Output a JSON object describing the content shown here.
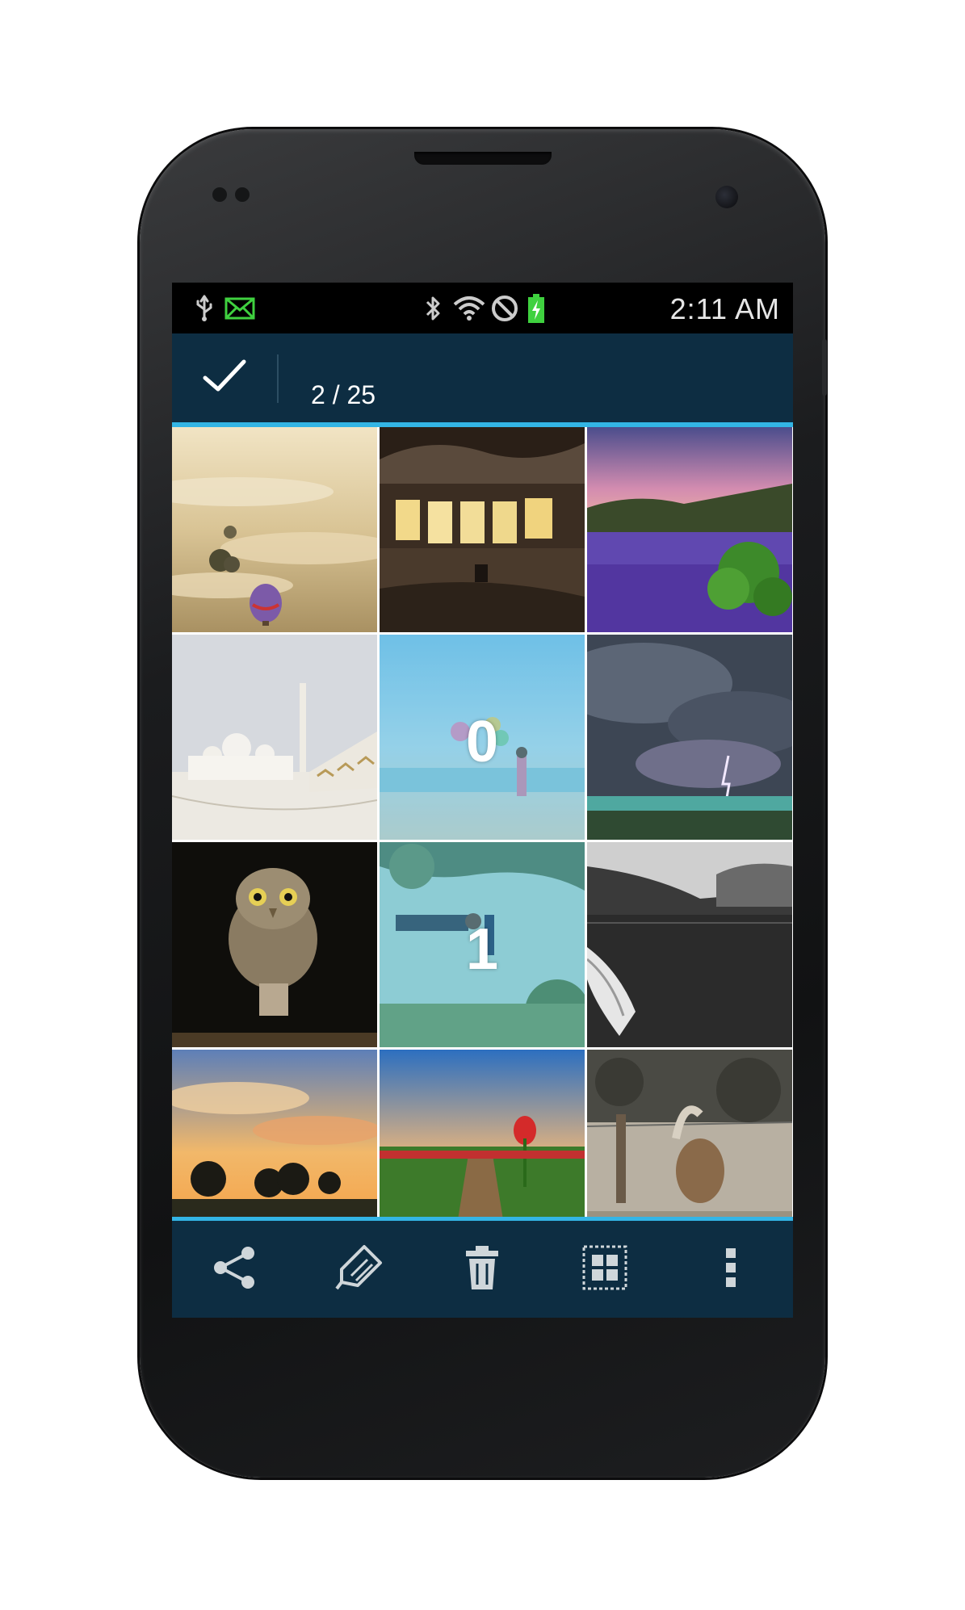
{
  "status_bar": {
    "time": "2:11 AM",
    "icons": [
      "usb-icon",
      "mail-icon",
      "bluetooth-icon",
      "wifi-icon",
      "blocked-icon",
      "battery-charging-icon"
    ]
  },
  "action_bar": {
    "done_icon": "checkmark-icon",
    "selection_count": "2 / 25"
  },
  "grid": {
    "tiles": [
      {
        "name": "fog-balloon-photo",
        "selected": false,
        "badge": ""
      },
      {
        "name": "abandoned-room-photo",
        "selected": false,
        "badge": ""
      },
      {
        "name": "lupine-field-photo",
        "selected": false,
        "badge": ""
      },
      {
        "name": "white-mosque-photo",
        "selected": false,
        "badge": ""
      },
      {
        "name": "beach-girl-balloons-photo",
        "selected": true,
        "badge": "0"
      },
      {
        "name": "storm-lightning-photo",
        "selected": false,
        "badge": ""
      },
      {
        "name": "owl-photo",
        "selected": false,
        "badge": ""
      },
      {
        "name": "couple-field-photo",
        "selected": true,
        "badge": "1"
      },
      {
        "name": "lake-canoe-photo",
        "selected": false,
        "badge": ""
      },
      {
        "name": "sunset-trees-photo",
        "selected": false,
        "badge": ""
      },
      {
        "name": "tulip-field-photo",
        "selected": false,
        "badge": ""
      },
      {
        "name": "horse-pasture-photo",
        "selected": false,
        "badge": ""
      }
    ]
  },
  "bottom_bar": {
    "buttons": [
      "share-icon",
      "tag-icon",
      "trash-icon",
      "select-all-icon",
      "overflow-menu-icon"
    ]
  },
  "colors": {
    "accent": "#33b5e5",
    "bar_background": "#0d2d42",
    "status_bar": "#000000"
  }
}
